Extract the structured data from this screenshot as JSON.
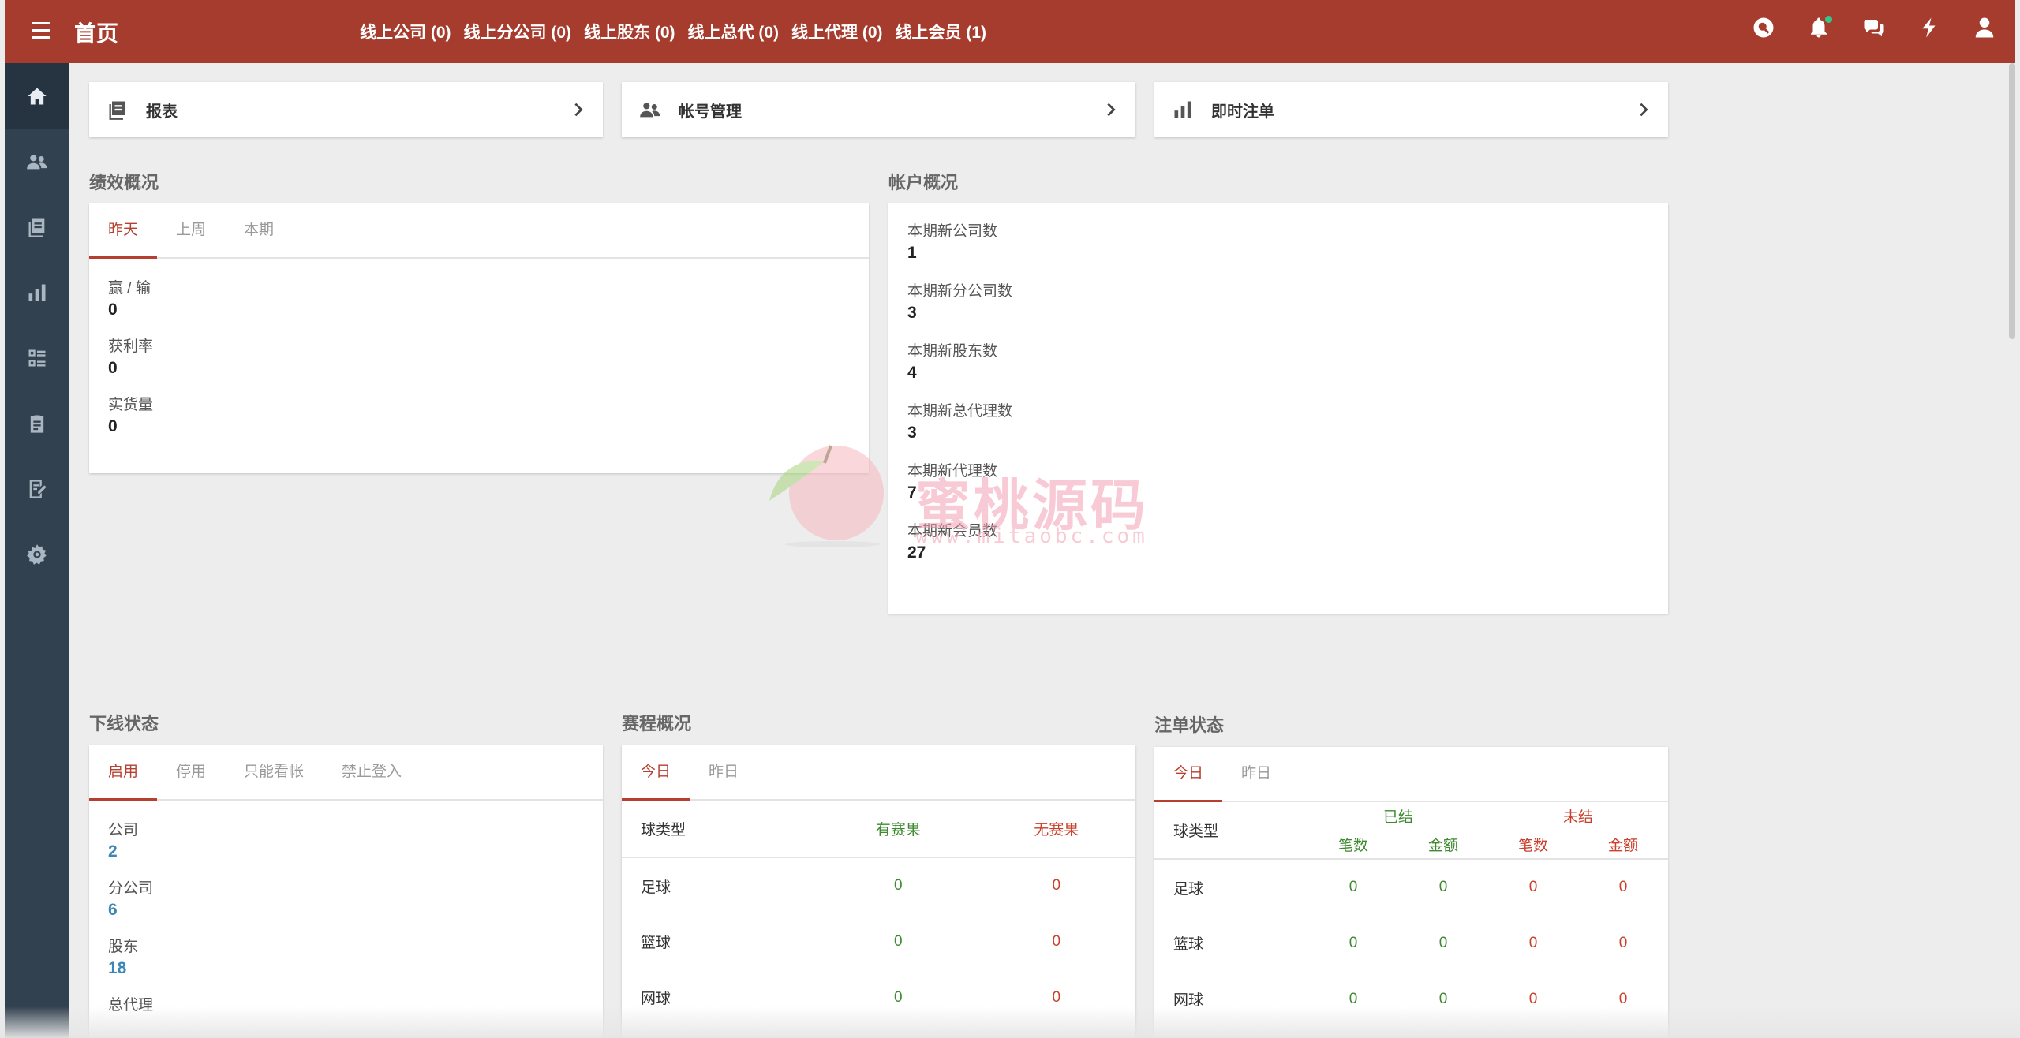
{
  "header": {
    "title": "首页",
    "online_links": [
      "线上公司 (0)",
      "线上分公司 (0)",
      "线上股东 (0)",
      "线上总代 (0)",
      "线上代理 (0)",
      "线上会员 (1)"
    ],
    "icons": [
      "search-icon",
      "bell-icon",
      "chat-icon",
      "lightning-icon",
      "user-icon"
    ],
    "notification_dot_color": "#36c68c",
    "bar_color": "#a53c2e"
  },
  "sidebar": {
    "items": [
      "home-icon",
      "users-icon",
      "report-icon",
      "chart-icon",
      "list-icon",
      "clipboard-icon",
      "edit-icon",
      "settings-icon"
    ],
    "bg_color": "#32414f"
  },
  "nav_cards": [
    {
      "label": "报表",
      "icon": "report-icon"
    },
    {
      "label": "帐号管理",
      "icon": "users-icon"
    },
    {
      "label": "即时注单",
      "icon": "chart-icon"
    }
  ],
  "performance": {
    "title": "绩效概况",
    "tabs": [
      "昨天",
      "上周",
      "本期"
    ],
    "active_tab": "昨天",
    "stats": [
      {
        "label": "赢 / 输",
        "value": "0"
      },
      {
        "label": "获利率",
        "value": "0"
      },
      {
        "label": "实货量",
        "value": "0"
      }
    ]
  },
  "accounts": {
    "title": "帐户概况",
    "stats": [
      {
        "label": "本期新公司数",
        "value": "1"
      },
      {
        "label": "本期新分公司数",
        "value": "3"
      },
      {
        "label": "本期新股东数",
        "value": "4"
      },
      {
        "label": "本期新总代理数",
        "value": "3"
      },
      {
        "label": "本期新代理数",
        "value": "7"
      },
      {
        "label": "本期新会员数",
        "value": "27"
      }
    ]
  },
  "downline": {
    "title": "下线状态",
    "tabs": [
      "启用",
      "停用",
      "只能看帐",
      "禁止登入"
    ],
    "active_tab": "启用",
    "stats": [
      {
        "label": "公司",
        "value": "2"
      },
      {
        "label": "分公司",
        "value": "6"
      },
      {
        "label": "股东",
        "value": "18"
      },
      {
        "label": "总代理",
        "value": ""
      }
    ]
  },
  "schedule": {
    "title": "赛程概况",
    "tabs": [
      "今日",
      "昨日"
    ],
    "active_tab": "今日",
    "columns": [
      "球类型",
      "有赛果",
      "无赛果"
    ],
    "rows": [
      {
        "sport": "足球",
        "with_result": "0",
        "without_result": "0"
      },
      {
        "sport": "篮球",
        "with_result": "0",
        "without_result": "0"
      },
      {
        "sport": "网球",
        "with_result": "0",
        "without_result": "0"
      }
    ]
  },
  "bets": {
    "title": "注单状态",
    "tabs": [
      "今日",
      "昨日"
    ],
    "active_tab": "今日",
    "col_sport": "球类型",
    "group_settled": "已结",
    "group_unsettled": "未结",
    "sub_count": "笔数",
    "sub_amount": "金额",
    "rows": [
      {
        "sport": "足球",
        "settled_count": "0",
        "settled_amount": "0",
        "unsettled_count": "0",
        "unsettled_amount": "0"
      },
      {
        "sport": "篮球",
        "settled_count": "0",
        "settled_amount": "0",
        "unsettled_count": "0",
        "unsettled_amount": "0"
      },
      {
        "sport": "网球",
        "settled_count": "0",
        "settled_amount": "0",
        "unsettled_count": "0",
        "unsettled_amount": "0"
      }
    ]
  },
  "watermark": {
    "text": "蜜桃源码",
    "url": "www.mitaobc.com"
  }
}
